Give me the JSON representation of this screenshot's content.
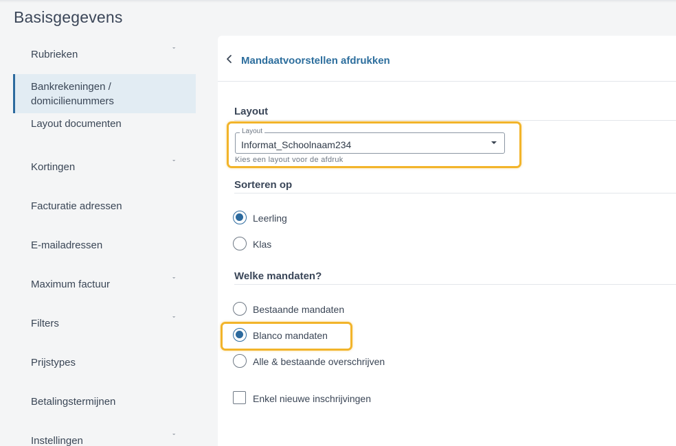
{
  "page": {
    "title": "Basisgegevens"
  },
  "sidebar": {
    "items": [
      {
        "label": "Rubrieken",
        "has_chevron": true
      },
      {
        "label_line1": "Bankrekeningen /",
        "label_line2": "domicilienummers",
        "active": true
      },
      {
        "label": "Layout documenten"
      },
      {
        "label": "Kortingen",
        "has_chevron": true
      },
      {
        "label": "Facturatie adressen"
      },
      {
        "label": "E-mailadressen"
      },
      {
        "label": "Maximum factuur",
        "has_chevron": true
      },
      {
        "label": "Filters",
        "has_chevron": true
      },
      {
        "label": "Prijstypes"
      },
      {
        "label": "Betalingstermijnen"
      },
      {
        "label": "Instellingen",
        "has_chevron": true
      }
    ],
    "chevron_glyph": "ˇ"
  },
  "panel": {
    "title": "Mandaatvoorstellen afdrukken",
    "layout_section": {
      "title": "Layout",
      "field_label": "Layout",
      "value": "Informat_Schoolnaam234",
      "helper": "Kies een layout voor de afdruk"
    },
    "sort_section": {
      "title": "Sorteren op",
      "options": [
        {
          "label": "Leerling",
          "checked": true
        },
        {
          "label": "Klas",
          "checked": false
        }
      ]
    },
    "mandates_section": {
      "title": "Welke mandaten?",
      "options": [
        {
          "label": "Bestaande mandaten",
          "checked": false
        },
        {
          "label": "Blanco mandaten",
          "checked": true
        },
        {
          "label": "Alle & bestaande overschrijven",
          "checked": false
        }
      ]
    },
    "checkbox": {
      "label": "Enkel nieuwe inschrijvingen",
      "checked": false
    }
  },
  "colors": {
    "accent": "#2c6a9e",
    "highlight": "#f2b42a"
  },
  "icons": {
    "back": "chevron-left-icon",
    "dropdown": "caret-down-icon"
  }
}
